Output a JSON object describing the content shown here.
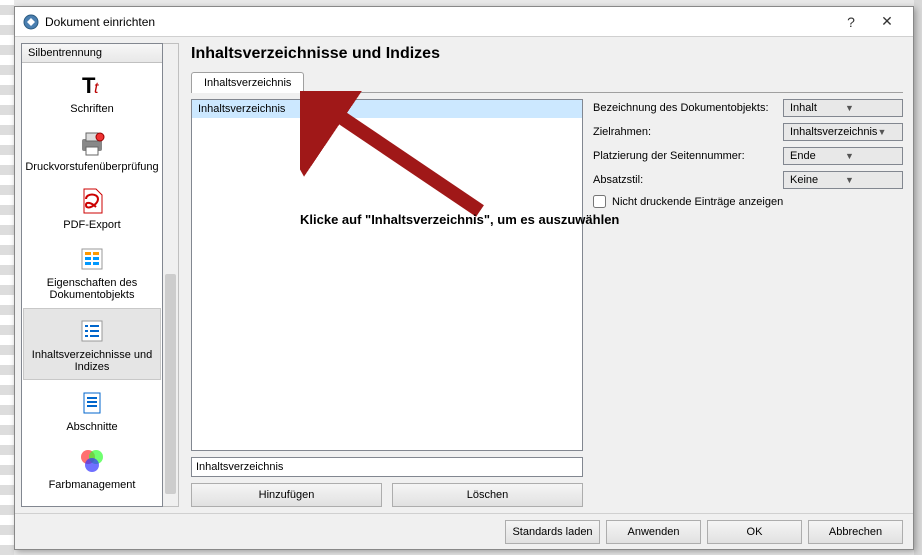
{
  "window": {
    "title": "Dokument einrichten",
    "help": "?",
    "close": "✕"
  },
  "sidebar": {
    "header": "Silbentrennung",
    "items": [
      {
        "label": "Schriften"
      },
      {
        "label": "Druckvorstufenüberprüfung"
      },
      {
        "label": "PDF-Export"
      },
      {
        "label": "Eigenschaften des Dokumentobjekts"
      },
      {
        "label": "Inhaltsverzeichnisse und Indizes"
      },
      {
        "label": "Abschnitte"
      },
      {
        "label": "Farbmanagement"
      }
    ]
  },
  "main": {
    "heading": "Inhaltsverzeichnisse und Indizes",
    "tab": "Inhaltsverzeichnis",
    "list_item": "Inhaltsverzeichnis",
    "input_value": "Inhaltsverzeichnis",
    "buttons": {
      "add": "Hinzufügen",
      "del": "Löschen"
    },
    "form": {
      "name_label": "Bezeichnung des Dokumentobjekts:",
      "name_value": "Inhalt",
      "frame_label": "Zielrahmen:",
      "frame_value": "Inhaltsverzeichnis",
      "page_label": "Platzierung der Seitennummer:",
      "page_value": "Ende",
      "style_label": "Absatzstil:",
      "style_value": "Keine",
      "check_label": "Nicht druckende Einträge anzeigen"
    }
  },
  "footer": {
    "defaults": "Standards laden",
    "apply": "Anwenden",
    "ok": "OK",
    "cancel": "Abbrechen"
  },
  "annotation": {
    "text": "Klicke auf \"Inhaltsverzeichnis\", um es auszuwählen"
  }
}
